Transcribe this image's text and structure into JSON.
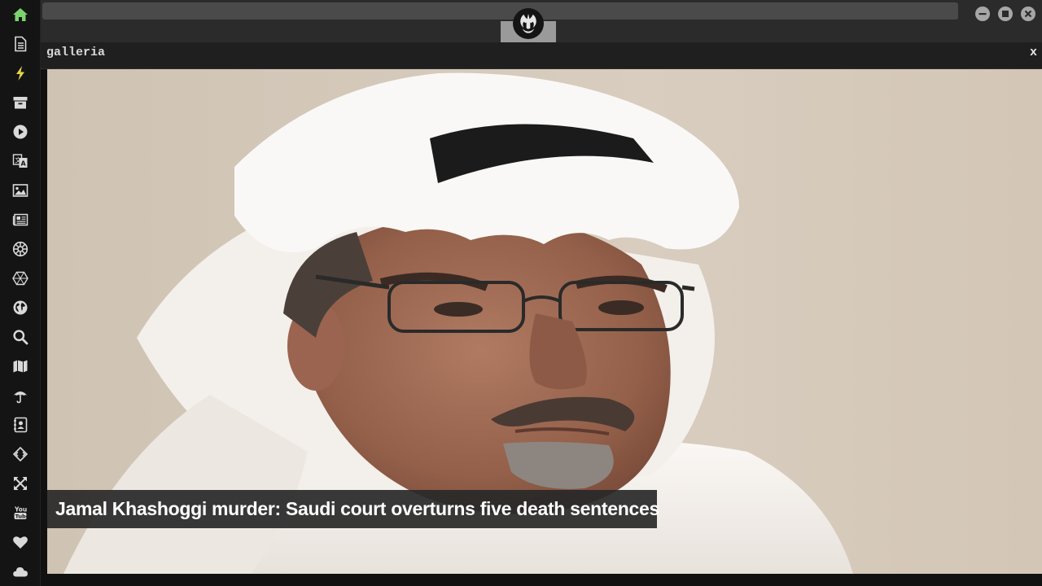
{
  "sidebar": {
    "items": [
      {
        "icon": "home-icon",
        "active": true,
        "color": "#7bd36d"
      },
      {
        "icon": "document-icon"
      },
      {
        "icon": "lightning-icon",
        "color": "#e8d24a"
      },
      {
        "icon": "archive-icon"
      },
      {
        "icon": "play-icon"
      },
      {
        "icon": "translate-icon"
      },
      {
        "icon": "image-icon"
      },
      {
        "icon": "newspaper-icon"
      },
      {
        "icon": "empire-icon"
      },
      {
        "icon": "hexagon-icon"
      },
      {
        "icon": "globe-icon"
      },
      {
        "icon": "search-icon"
      },
      {
        "icon": "map-icon"
      },
      {
        "icon": "umbrella-icon"
      },
      {
        "icon": "contact-book-icon"
      },
      {
        "icon": "code-diamond-icon"
      },
      {
        "icon": "expand-icon"
      },
      {
        "icon": "youtube-icon"
      },
      {
        "icon": "heart-icon"
      },
      {
        "icon": "cloud-icon"
      }
    ]
  },
  "topbar": {
    "logo": "rebel-alliance-icon",
    "window_buttons": [
      "minimize-icon",
      "maximize-icon",
      "close-icon"
    ]
  },
  "panel": {
    "title": "galleria",
    "close_label": "x"
  },
  "gallery": {
    "caption": "Jamal Khashoggi murder: Saudi court overturns five death sentences"
  },
  "colors": {
    "sidebar_bg": "#141414",
    "icon": "#d9d9d9",
    "home_icon": "#7bd36d",
    "lightning_icon": "#e8d24a",
    "topbar_bg": "#2b2b2b"
  }
}
